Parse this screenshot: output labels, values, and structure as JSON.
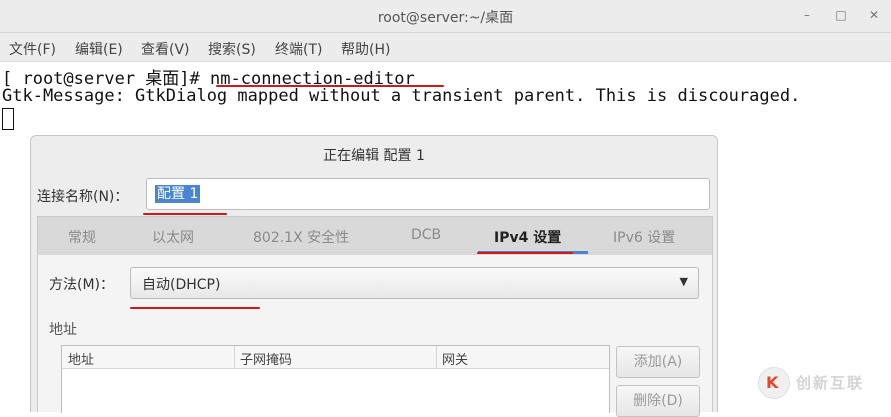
{
  "window": {
    "title": "root@server:~/桌面",
    "minimize": "–",
    "maximize": "□",
    "close": "✕"
  },
  "menubar": [
    "文件(F)",
    "编辑(E)",
    "查看(V)",
    "搜索(S)",
    "终端(T)",
    "帮助(H)"
  ],
  "terminal": {
    "prompt": "[ root@server 桌面]#",
    "command": "nm-connection-editor",
    "message": "Gtk-Message: GtkDialog mapped without a transient parent. This is discouraged."
  },
  "dialog": {
    "title": "正在编辑 配置 1",
    "connection_name_label": "连接名称(N)：",
    "connection_name_value": "配置 1",
    "tabs": [
      "常规",
      "以太网",
      "802.1X 安全性",
      "DCB",
      "IPv4 设置",
      "IPv6 设置"
    ],
    "active_tab": "IPv4 设置",
    "method_label": "方法(M)：",
    "method_value": "自动(DHCP)",
    "address_heading": "地址",
    "address_columns": [
      "地址",
      "子网掩码",
      "网关"
    ],
    "add_button": "添加(A)",
    "delete_button": "删除(D)"
  },
  "watermark": {
    "text": "创新互联",
    "mark": "K"
  },
  "colors": {
    "accent": "#4a86d0",
    "annotation": "#d01818"
  }
}
